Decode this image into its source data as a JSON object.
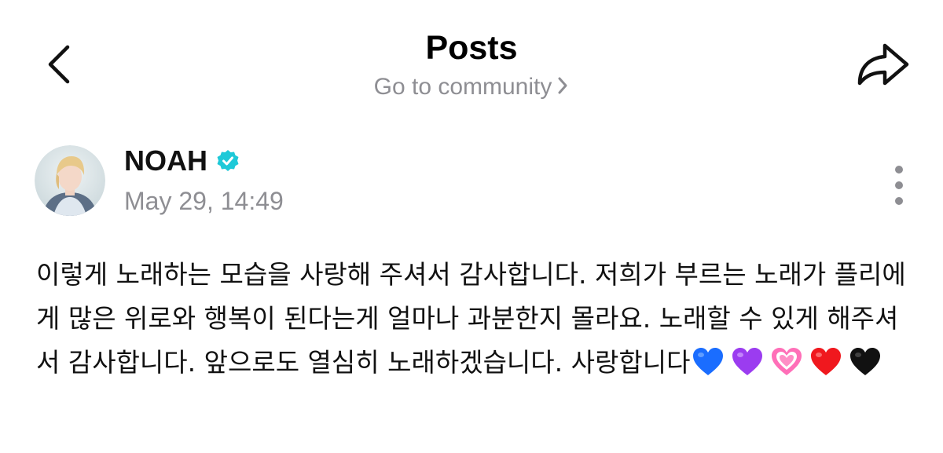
{
  "header": {
    "title": "Posts",
    "community_link": "Go to community"
  },
  "icons": {
    "back": "back-chevron-icon",
    "share": "share-arrow-icon",
    "verified": "verified-badge-icon",
    "more": "more-vertical-icon"
  },
  "colors": {
    "verified_badge": "#1ec9d8",
    "secondary_text": "#8e8e93",
    "primary_text": "#111111"
  },
  "post": {
    "author": "NOAH",
    "timestamp": "May 29, 14:49",
    "body": "이렇게 노래하는 모습을 사랑해 주셔서 감사합니다. 저희가 부르는 노래가 플리에게 많은 위로와 행복이 된다는게 얼마나 과분한지 몰라요. 노래할 수 있게 해주셔서 감사합니다. 앞으로도 열심히 노래하겠습니다. 사랑합니다",
    "emojis": [
      "blue-heart",
      "purple-heart",
      "sparkling-pink-heart",
      "red-heart",
      "black-heart"
    ]
  }
}
